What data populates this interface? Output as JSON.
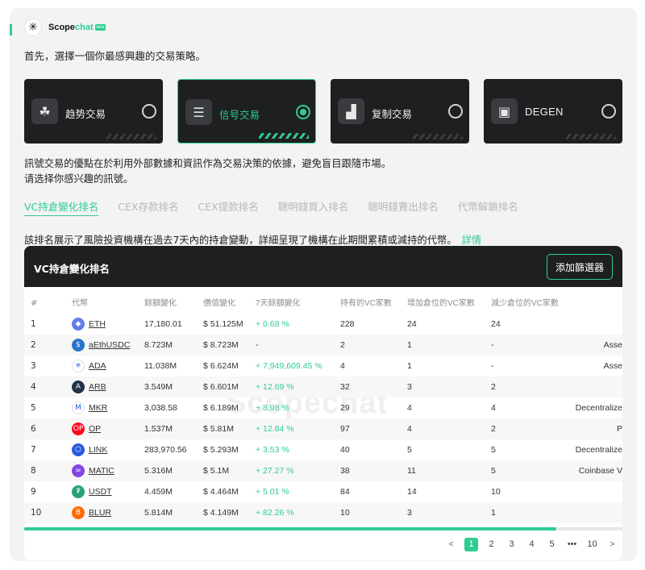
{
  "brand": {
    "name_main": "Scope",
    "name_accent": "chat",
    "badge": "beta",
    "logo_icon": "compass-star-icon"
  },
  "colors": {
    "accent": "#2fcd91",
    "dark_card": "#1e1f21",
    "panel_bg": "#f3f3f3"
  },
  "intro": "首先，選擇一個你最感興趣的交易策略。",
  "strategies": [
    {
      "label": "趋势交易",
      "icon": "hand-growth-icon",
      "selected": false
    },
    {
      "label": "信号交易",
      "icon": "database-signal-icon",
      "selected": true
    },
    {
      "label": "复制交易",
      "icon": "bar-chart-icon",
      "selected": false
    },
    {
      "label": "DEGEN",
      "icon": "chart-window-icon",
      "selected": false
    }
  ],
  "description": {
    "line1": "訊號交易的優點在於利用外部數據和資訊作為交易決策的依據，避免盲目跟隨市場。",
    "line2": "请选择你感兴趣的訊號。"
  },
  "tabs": [
    "VC持倉變化排名",
    "CEX存款排名",
    "CEX提款排名",
    "聰明錢買入排名",
    "聰明錢賣出排名",
    "代幣解鎖排名"
  ],
  "active_tab": 0,
  "tab_description": {
    "text": "該排名展示了風險投資機構在過去7天內的持倉變動，詳細呈現了機構在此期間累積或減持的代幣。",
    "link": "詳情"
  },
  "panel": {
    "title": "VC持倉變化排名",
    "filter_button": "添加篩選器",
    "watermark": "Scopechat"
  },
  "table": {
    "headers": [
      "#",
      "代幣",
      "餘額變化",
      "價值變化",
      "7天餘額變化",
      "持有的VC家數",
      "增加倉位的VC家數",
      "減少倉位的VC家數"
    ],
    "rows": [
      {
        "rank": "1",
        "symbol": "ETH",
        "icon": "ethereum-icon",
        "icon_color": "#627eea",
        "icon_glyph": "◆",
        "amount": "17,180.01",
        "value": "$ 51.125M",
        "pct": "+ 0.68 %",
        "holders": "228",
        "inc": "24",
        "dec": "24",
        "tag": ""
      },
      {
        "rank": "2",
        "symbol": "aEthUSDC",
        "icon": "aave-usdc-icon",
        "icon_color": "#2775ca",
        "icon_glyph": "$",
        "amount": "8.723M",
        "value": "$ 8.723M",
        "pct": "-",
        "holders": "2",
        "inc": "1",
        "dec": "-",
        "tag": "Asse"
      },
      {
        "rank": "3",
        "symbol": "ADA",
        "icon": "cardano-icon",
        "icon_color": "#ffffff",
        "icon_glyph": "✳",
        "amount": "11.038M",
        "value": "$ 6.624M",
        "pct": "+ 7,949,609.45 %",
        "holders": "4",
        "inc": "1",
        "dec": "-",
        "tag": "Asse"
      },
      {
        "rank": "4",
        "symbol": "ARB",
        "icon": "arbitrum-icon",
        "icon_color": "#213147",
        "icon_glyph": "A",
        "amount": "3.549M",
        "value": "$ 6.601M",
        "pct": "+ 12.69 %",
        "holders": "32",
        "inc": "3",
        "dec": "2",
        "tag": ""
      },
      {
        "rank": "5",
        "symbol": "MKR",
        "icon": "maker-icon",
        "icon_color": "#ffffff",
        "icon_glyph": "M",
        "amount": "3,038.58",
        "value": "$ 6.189M",
        "pct": "+ 8.98 %",
        "holders": "29",
        "inc": "4",
        "dec": "4",
        "tag": "Decentralize"
      },
      {
        "rank": "6",
        "symbol": "OP",
        "icon": "optimism-icon",
        "icon_color": "#ff0420",
        "icon_glyph": "OP",
        "amount": "1.537M",
        "value": "$ 5.81M",
        "pct": "+ 12.84 %",
        "holders": "97",
        "inc": "4",
        "dec": "2",
        "tag": "P"
      },
      {
        "rank": "7",
        "symbol": "LINK",
        "icon": "chainlink-icon",
        "icon_color": "#2a5ada",
        "icon_glyph": "⬡",
        "amount": "283,970.56",
        "value": "$ 5.293M",
        "pct": "+ 3.53 %",
        "holders": "40",
        "inc": "5",
        "dec": "5",
        "tag": "Decentralize"
      },
      {
        "rank": "8",
        "symbol": "MATIC",
        "icon": "polygon-icon",
        "icon_color": "#8247e5",
        "icon_glyph": "∞",
        "amount": "5.316M",
        "value": "$ 5.1M",
        "pct": "+ 27.27 %",
        "holders": "38",
        "inc": "11",
        "dec": "5",
        "tag": "Coinbase V"
      },
      {
        "rank": "9",
        "symbol": "USDT",
        "icon": "tether-icon",
        "icon_color": "#26a17b",
        "icon_glyph": "₮",
        "amount": "4.459M",
        "value": "$ 4.464M",
        "pct": "+ 5.01 %",
        "holders": "84",
        "inc": "14",
        "dec": "10",
        "tag": ""
      },
      {
        "rank": "10",
        "symbol": "BLUR",
        "icon": "blur-icon",
        "icon_color": "#ff6b00",
        "icon_glyph": "B",
        "amount": "5.814M",
        "value": "$ 4.149M",
        "pct": "+ 82.26 %",
        "holders": "10",
        "inc": "3",
        "dec": "1",
        "tag": ""
      }
    ]
  },
  "scrollbar": {
    "position_fraction": 0.89
  },
  "pagination": {
    "prev": "<",
    "pages": [
      "1",
      "2",
      "3",
      "4",
      "5"
    ],
    "ellipsis": "•••",
    "last": "10",
    "next": ">",
    "current": "1"
  }
}
